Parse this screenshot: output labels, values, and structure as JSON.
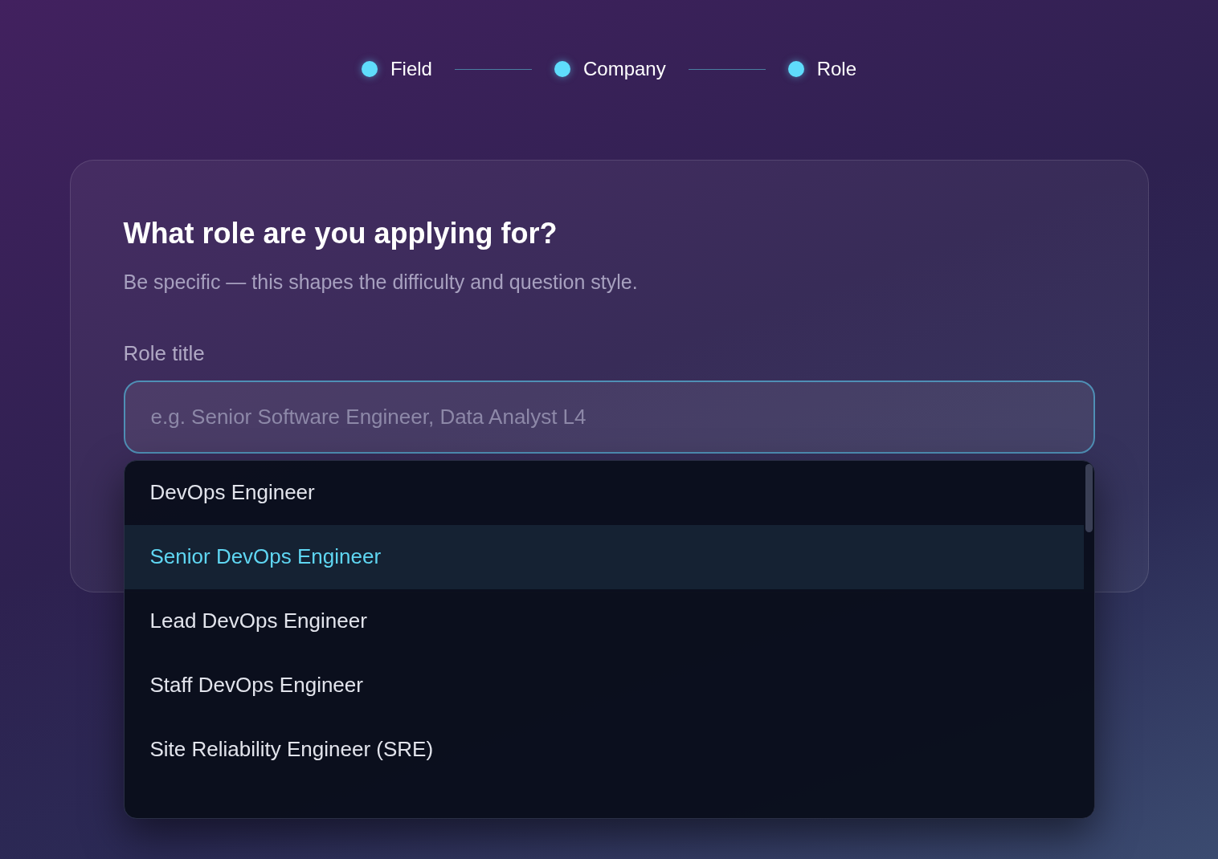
{
  "steps": [
    {
      "label": "Field",
      "done": true
    },
    {
      "label": "Company",
      "done": true
    },
    {
      "label": "Role",
      "done": true
    }
  ],
  "card": {
    "title": "What role are you applying for?",
    "subtitle": "Be specific — this shapes the difficulty and question style.",
    "field": {
      "label": "Role title",
      "placeholder": "e.g. Senior Software Engineer, Data Analyst L4"
    }
  },
  "suggestions": [
    {
      "label": "DevOps Engineer",
      "selected": false
    },
    {
      "label": "Senior DevOps Engineer",
      "selected": true
    },
    {
      "label": "Lead DevOps Engineer",
      "selected": false
    },
    {
      "label": "Staff DevOps Engineer",
      "selected": false
    },
    {
      "label": "Site Reliability Engineer (SRE)",
      "selected": false
    }
  ]
}
